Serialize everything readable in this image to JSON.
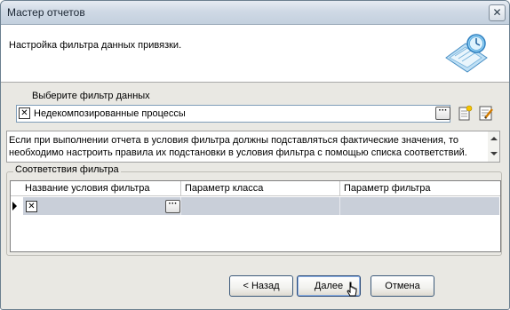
{
  "window": {
    "title": "Мастер отчетов",
    "close_glyph": "✕"
  },
  "header": {
    "text": "Настройка фильтра данных привязки.",
    "icon": "report-wizard-icon"
  },
  "filter": {
    "label": "Выберите фильтр данных",
    "clear_glyph": "✕",
    "value": "Недекомпозированные процессы",
    "browse_glyph": "···"
  },
  "info": {
    "text": "Если при выполнении отчета в условия фильтра должны подставляться фактические значения, то необходимо настроить правила их подстановки в условия фильтра с помощью списка соответствий."
  },
  "mapping": {
    "group_title": "Соответствия фильтра",
    "columns": [
      "Название условия фильтра",
      "Параметр класса",
      "Параметр фильтра"
    ],
    "row": {
      "clear_glyph": "✕",
      "browse_glyph": "···"
    }
  },
  "buttons": {
    "back": "< Назад",
    "next": "Далее",
    "cancel": "Отмена"
  },
  "colors": {
    "selected_row": "#c9cfd9",
    "title_bar": "#cfd9e5",
    "dialog_bg": "#e9e8e3"
  }
}
